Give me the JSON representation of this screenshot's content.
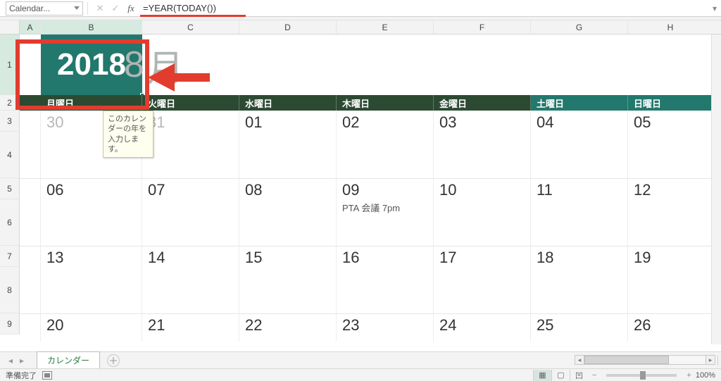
{
  "formula_bar": {
    "name_box": "Calendar...",
    "formula": "=YEAR(TODAY())"
  },
  "columns": [
    "A",
    "B",
    "C",
    "D",
    "E",
    "F",
    "G",
    "H"
  ],
  "rows": [
    "1",
    "2",
    "3",
    "4",
    "5",
    "6",
    "7",
    "8",
    "9"
  ],
  "title": {
    "year": "2018",
    "month_partial": "8",
    "month_suffix": "月"
  },
  "tooltip_text": "このカレンダーの年を入力します。",
  "weekdays": [
    "月曜日",
    "火曜日",
    "水曜日",
    "木曜日",
    "金曜日",
    "土曜日",
    "日曜日"
  ],
  "weeks": [
    {
      "days": [
        "30",
        "31",
        "01",
        "02",
        "03",
        "04",
        "05"
      ],
      "grey": [
        true,
        true,
        false,
        false,
        false,
        false,
        false
      ]
    },
    {
      "days": [
        "06",
        "07",
        "08",
        "09",
        "10",
        "11",
        "12"
      ],
      "grey": [
        false,
        false,
        false,
        false,
        false,
        false,
        false
      ],
      "events": {
        "3": "PTA 会議 7pm"
      }
    },
    {
      "days": [
        "13",
        "14",
        "15",
        "16",
        "17",
        "18",
        "19"
      ],
      "grey": [
        false,
        false,
        false,
        false,
        false,
        false,
        false
      ]
    },
    {
      "days": [
        "20",
        "21",
        "22",
        "23",
        "24",
        "25",
        "26"
      ],
      "grey": [
        false,
        false,
        false,
        false,
        false,
        false,
        false
      ]
    }
  ],
  "sheet_tab": "カレンダー",
  "status_text": "準備完了",
  "zoom_label": "100%"
}
